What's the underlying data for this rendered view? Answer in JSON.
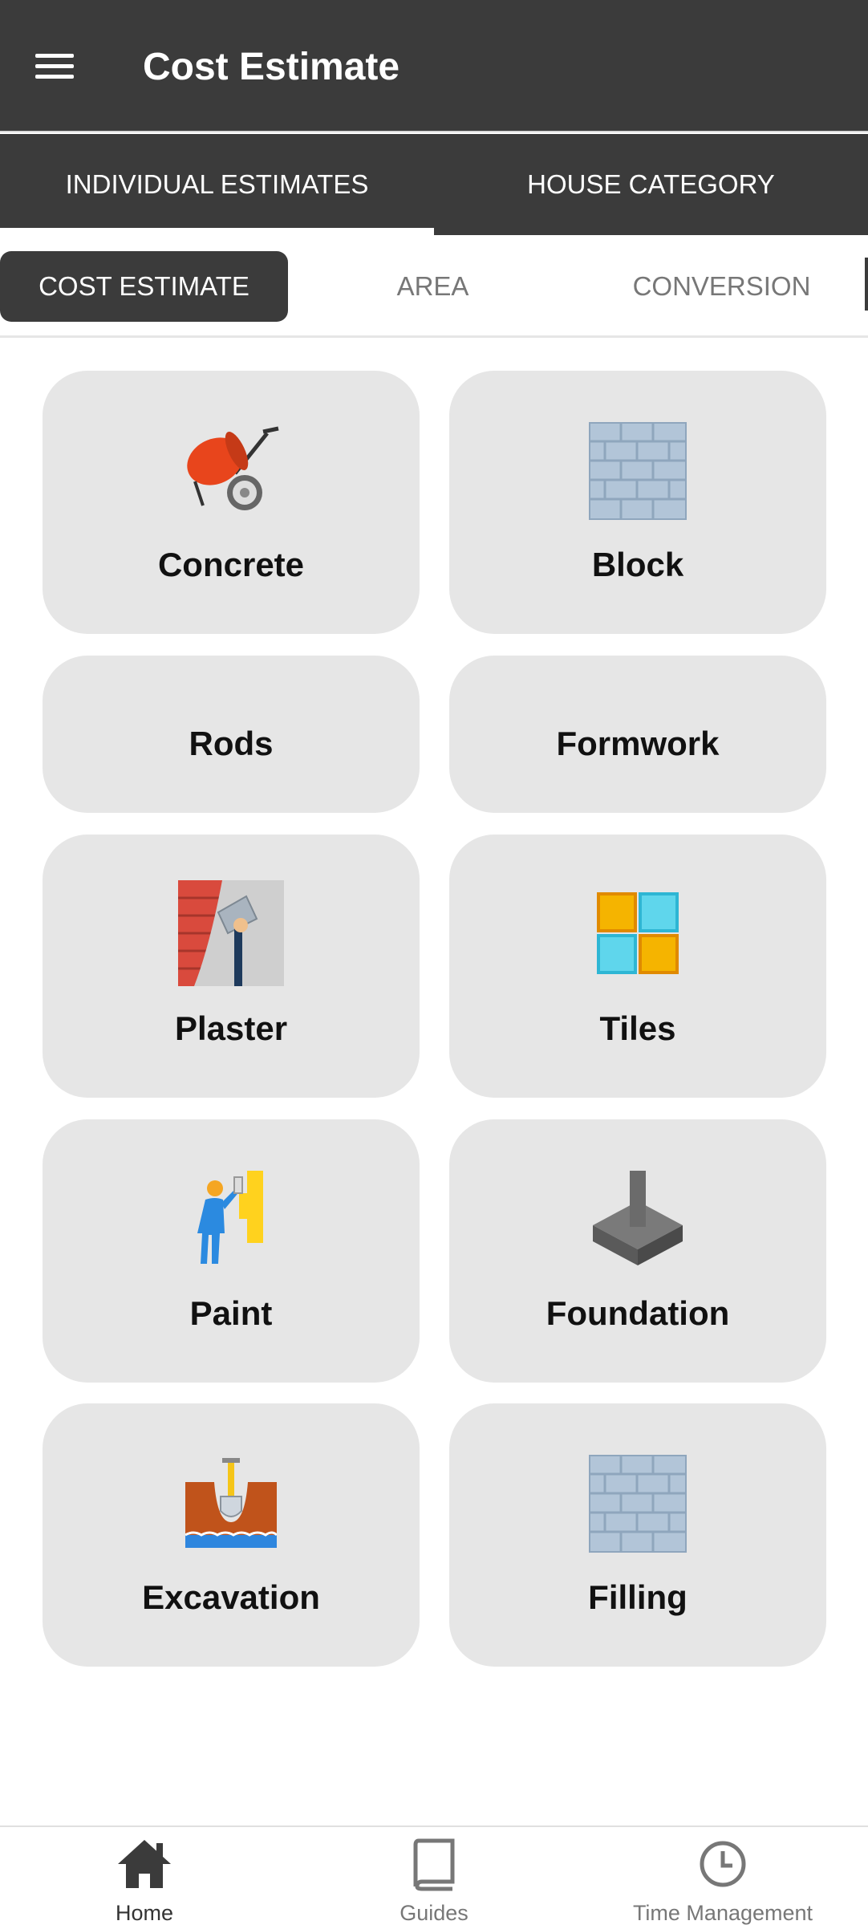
{
  "app": {
    "title": "Cost Estimate",
    "menu_icon": "hamburger-menu-icon"
  },
  "main_tabs": [
    {
      "label": "INDIVIDUAL ESTIMATES",
      "active": true
    },
    {
      "label": "HOUSE CATEGORY",
      "active": false
    }
  ],
  "sub_tabs": [
    {
      "label": "COST ESTIMATE",
      "active": true
    },
    {
      "label": "AREA",
      "active": false
    },
    {
      "label": "CONVERSION",
      "active": false
    }
  ],
  "cards": [
    {
      "label": "Concrete",
      "icon": "concrete-mixer-icon"
    },
    {
      "label": "Block",
      "icon": "brick-wall-icon"
    },
    {
      "label": "Rods",
      "icon": ""
    },
    {
      "label": "Formwork",
      "icon": ""
    },
    {
      "label": "Plaster",
      "icon": "plastering-trowel-icon"
    },
    {
      "label": "Tiles",
      "icon": "tiles-icon"
    },
    {
      "label": "Paint",
      "icon": "painter-icon"
    },
    {
      "label": "Foundation",
      "icon": "foundation-footing-icon"
    },
    {
      "label": "Excavation",
      "icon": "shovel-trench-icon"
    },
    {
      "label": "Filling",
      "icon": "brick-wall-icon"
    }
  ],
  "bottom_nav": [
    {
      "label": "Home",
      "icon": "home-icon",
      "active": true
    },
    {
      "label": "Guides",
      "icon": "book-icon",
      "active": false
    },
    {
      "label": "Time Management",
      "icon": "clock-icon",
      "active": false
    }
  ],
  "colors": {
    "bar": "#3b3b3b",
    "card": "#e6e6e6",
    "inactive_text": "#777777"
  }
}
